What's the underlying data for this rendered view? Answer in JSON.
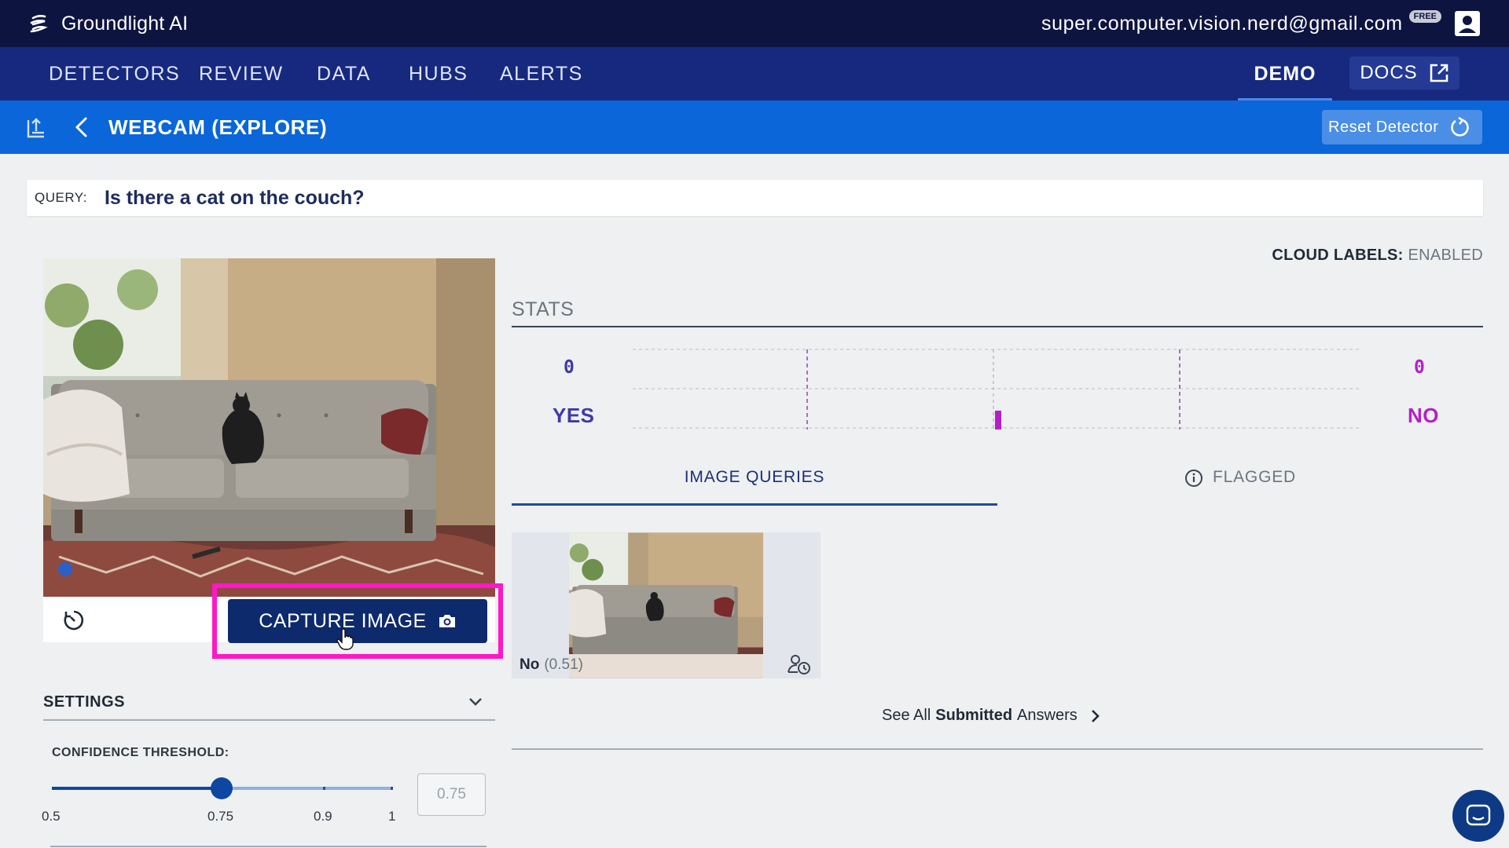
{
  "app": {
    "brand_name": "Groundlight AI",
    "user_email": "super.computer.vision.nerd@gmail.com",
    "plan_badge": "FREE"
  },
  "nav": {
    "items": [
      {
        "label": "DETECTORS"
      },
      {
        "label": "REVIEW"
      },
      {
        "label": "DATA"
      },
      {
        "label": "HUBS"
      },
      {
        "label": "ALERTS"
      }
    ],
    "demo_label": "DEMO",
    "docs_label": "DOCS"
  },
  "detector": {
    "title": "WEBCAM (EXPLORE)",
    "reset_label": "Reset Detector"
  },
  "query": {
    "label": "QUERY:",
    "text": "Is there a cat on the couch?"
  },
  "camera": {
    "capture_label": "CAPTURE IMAGE"
  },
  "settings": {
    "title": "SETTINGS",
    "confidence_label": "CONFIDENCE THRESHOLD:",
    "slider_value": 0.75,
    "slider_marks": [
      "0.5",
      "0.75",
      "0.9",
      "1"
    ],
    "input_value": "0.75"
  },
  "cloud_labels": {
    "key": "CLOUD LABELS:",
    "value": "ENABLED"
  },
  "stats": {
    "title": "STATS",
    "yes_count": "0",
    "yes_label": "YES",
    "no_count": "0",
    "no_label": "NO"
  },
  "tabs": {
    "image_queries": "IMAGE QUERIES",
    "flagged": "FLAGGED"
  },
  "image_queries": [
    {
      "answer": "No",
      "confidence": "(0.51)"
    }
  ],
  "answers_link": {
    "prefix": "See All",
    "bold": "Submitted",
    "suffix": "Answers"
  },
  "colors": {
    "topbar": "#0e1440",
    "navbar": "#17297e",
    "detector_bar": "#0a66d9",
    "highlight": "#ff17c8",
    "yes": "#3f3aa8",
    "no": "#b51fc9"
  }
}
